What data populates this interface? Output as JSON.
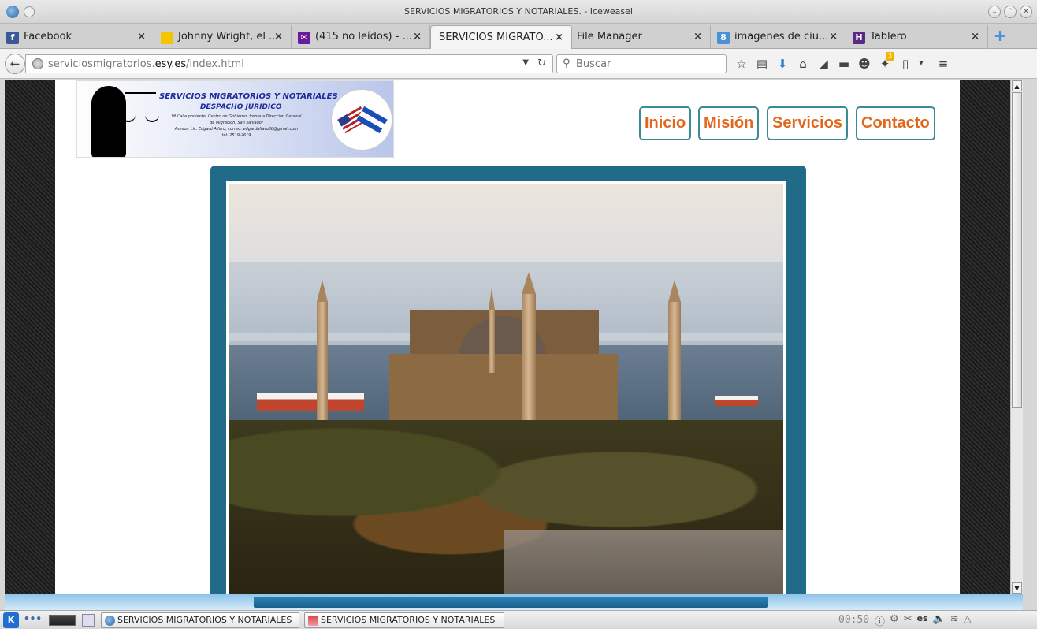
{
  "window": {
    "title": "SERVICIOS MIGRATORIOS Y NOTARIALES. - Iceweasel"
  },
  "tabs": [
    {
      "label": "Facebook",
      "icon": "facebook-icon",
      "color": "#3b5998"
    },
    {
      "label": "Johnny Wright, el ...",
      "icon": "yellow-page-icon",
      "color": "#f5c400"
    },
    {
      "label": "(415 no leídos) - ...",
      "icon": "mail-icon",
      "color": "#6a1b9a"
    },
    {
      "label": "SERVICIOS MIGRATO...",
      "icon": "none",
      "active": true
    },
    {
      "label": "File Manager",
      "icon": "none"
    },
    {
      "label": "imagenes de ciu...",
      "icon": "google-icon",
      "color": "#4a90d9"
    },
    {
      "label": "Tablero",
      "icon": "tablero-icon",
      "color": "#5b2a86"
    }
  ],
  "nav": {
    "url_plain": "serviciosmigratorios.",
    "url_domain": "esy.es",
    "url_path": "/index.html",
    "search_placeholder": "Buscar",
    "badge": "3"
  },
  "site": {
    "logo": {
      "title": "SERVICIOS MIGRATORIOS Y NOTARIALES",
      "subtitle": "DESPACHO JURIDICO",
      "address1": "9ª Calle poniente, Centro de Gobierno, frente a Direccion General",
      "address2": "de Migracion, San salvador",
      "asesor": "Asesor: Lic. Edgard Alfaro, correo: edgardalfaro38@gmail.com",
      "tel": "tel: 2519-2619"
    },
    "menu": [
      "Inicio",
      "Misión",
      "Servicios",
      "Contacto"
    ],
    "colors": {
      "accent": "#e2671c",
      "border": "#3b8b96",
      "frame": "#1f6b88"
    }
  },
  "taskbar": {
    "tasks": [
      "SERVICIOS MIGRATORIOS Y NOTARIALES",
      "SERVICIOS MIGRATORIOS Y NOTARIALES"
    ],
    "clock": "00:50",
    "lang": "es"
  }
}
